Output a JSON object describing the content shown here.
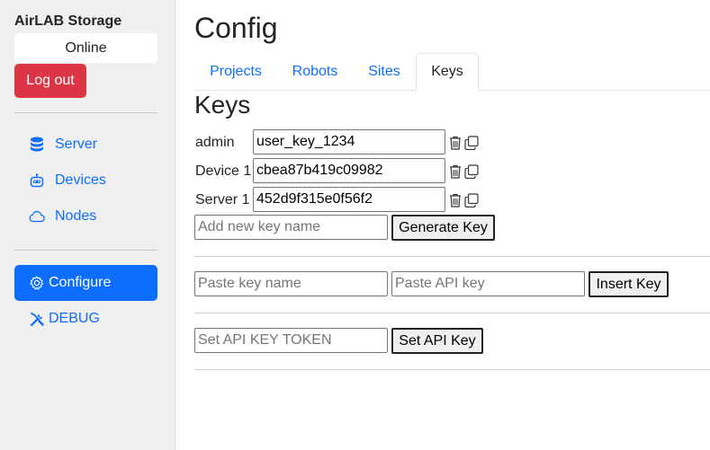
{
  "sidebar": {
    "brand": "AirLAB Storage",
    "status": "Online",
    "logout_label": "Log out",
    "nav": [
      {
        "label": "Server",
        "icon": "database-icon"
      },
      {
        "label": "Devices",
        "icon": "robot-icon"
      },
      {
        "label": "Nodes",
        "icon": "cloud-icon"
      }
    ],
    "tools": [
      {
        "label": "Configure",
        "icon": "gear-icon",
        "active": true
      },
      {
        "label": "DEBUG",
        "icon": "tools-icon",
        "active": false
      }
    ]
  },
  "main": {
    "title": "Config",
    "tabs": [
      {
        "label": "Projects"
      },
      {
        "label": "Robots"
      },
      {
        "label": "Sites"
      },
      {
        "label": "Keys",
        "active": true
      }
    ],
    "section_title": "Keys",
    "keys": [
      {
        "name": "admin",
        "value": "user_key_1234"
      },
      {
        "name": "Device 1",
        "value": "cbea87b419c09982"
      },
      {
        "name": "Server 1",
        "value": "452d9f315e0f56f2"
      }
    ],
    "new_key": {
      "placeholder": "Add new key name",
      "button": "Generate Key"
    },
    "insert_key": {
      "name_placeholder": "Paste key name",
      "key_placeholder": "Paste API key",
      "button": "Insert Key"
    },
    "token": {
      "placeholder": "Set API KEY TOKEN",
      "button": "Set API Key"
    }
  },
  "colors": {
    "primary": "#0d6efd",
    "danger": "#dc3545",
    "sidebar_bg": "#f0f0f0"
  }
}
